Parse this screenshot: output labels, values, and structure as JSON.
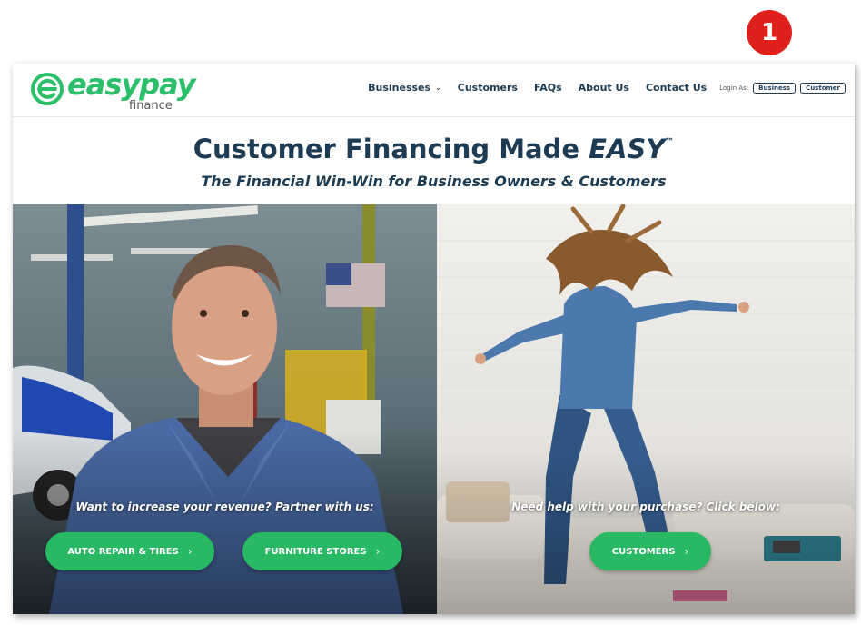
{
  "marker": {
    "label": "1"
  },
  "logo": {
    "word": "easypay",
    "sub": "finance"
  },
  "nav": {
    "items": [
      "Businesses",
      "Customers",
      "FAQs",
      "About Us",
      "Contact Us"
    ],
    "login_label": "Login As:",
    "login_business": "Business",
    "login_customer": "Customer"
  },
  "hero": {
    "title_prefix": "Customer Financing Made",
    "title_emph": "EASY",
    "title_tm": "™",
    "subtitle": "The Financial Win-Win for Business Owners & Customers"
  },
  "left_panel": {
    "prompt": "Want to increase your revenue? Partner with us:",
    "button1": "AUTO REPAIR & TIRES",
    "button2": "FURNITURE STORES"
  },
  "right_panel": {
    "prompt": "Need help with your purchase? Click below:",
    "button": "CUSTOMERS"
  },
  "icons": {
    "chevron": "chevron-down-icon",
    "arrow": "chevron-right-icon"
  },
  "colors": {
    "brand_green": "#2bbf6a",
    "button_green": "#29b864",
    "navy": "#1d3b53",
    "marker_red": "#e0201b"
  }
}
